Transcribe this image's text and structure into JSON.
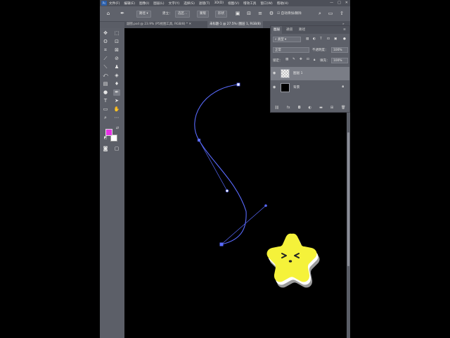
{
  "menubar": {
    "logo": "Ps",
    "items": [
      "文件(F)",
      "编辑(E)",
      "图像(I)",
      "图层(L)",
      "文字(Y)",
      "选择(S)",
      "滤镜(T)",
      "3D(D)",
      "视图(V)",
      "增效工具",
      "窗口(W)",
      "帮助(H)"
    ],
    "window_controls": [
      "—",
      "□",
      "✕"
    ]
  },
  "options": {
    "mode_select": "路径",
    "build_label": "建立：",
    "selection_button": "选区...",
    "mask_button": "蒙版",
    "shape_button": "形状",
    "auto_add_delete": "自动添加/删除"
  },
  "tabs": [
    {
      "label": "副图.psd @ 23.9% (P5抠图工具, RGB/8) *"
    },
    {
      "label": "未标题-1 @ 27.5% (图层 1, RGB/8)"
    }
  ],
  "layers_panel": {
    "tabs": [
      "图层",
      "通道",
      "路径"
    ],
    "filter_select": "类型",
    "blend_mode": "正常",
    "opacity_label": "不透明度：",
    "opacity_value": "100%",
    "lock_label": "锁定：",
    "fill_label": "填充：",
    "fill_value": "100%",
    "layers": [
      {
        "name": "图层 1",
        "selected": true
      },
      {
        "name": "背景",
        "locked": true
      }
    ]
  },
  "colors": {
    "foreground": "#e633e6",
    "background": "#ffffff",
    "path": "#5a6bff",
    "star": "#f5f23a"
  }
}
